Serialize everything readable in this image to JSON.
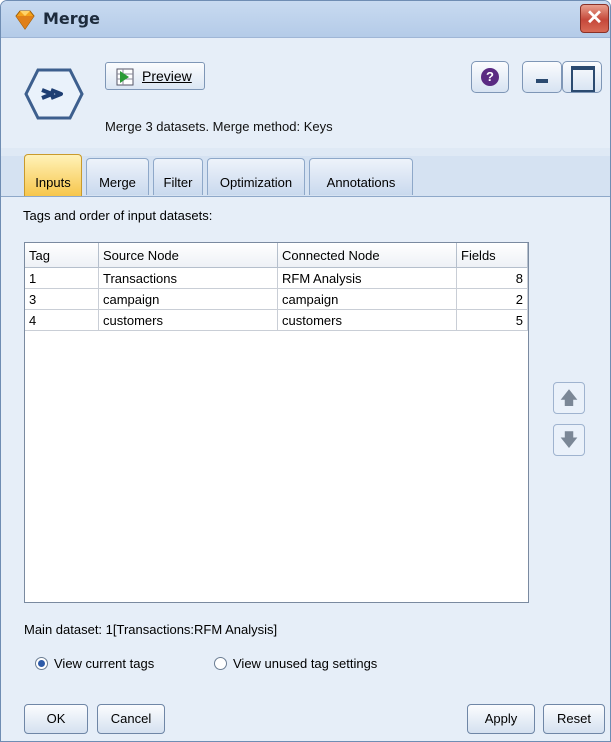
{
  "window": {
    "title": "Merge",
    "close_icon": "close-icon",
    "title_icon": "diamond-gem-icon"
  },
  "toolbar": {
    "preview_label": "Preview",
    "help_icon": "help-icon",
    "minimize_icon": "minimize-icon",
    "maximize_icon": "maximize-icon"
  },
  "node": {
    "icon": "merge-node-icon",
    "summary": "Merge 3 datasets. Merge method: Keys"
  },
  "tabs": [
    {
      "label": "Inputs",
      "active": true
    },
    {
      "label": "Merge",
      "active": false
    },
    {
      "label": "Filter",
      "active": false
    },
    {
      "label": "Optimization",
      "active": false
    },
    {
      "label": "Annotations",
      "active": false
    }
  ],
  "inputs": {
    "section_label": "Tags and order of input datasets:",
    "columns": [
      "Tag",
      "Source Node",
      "Connected Node",
      "Fields"
    ],
    "rows": [
      {
        "tag": "1",
        "source": "Transactions",
        "connected": "RFM Analysis",
        "fields": "8"
      },
      {
        "tag": "3",
        "source": "campaign",
        "connected": "campaign",
        "fields": "2"
      },
      {
        "tag": "4",
        "source": "customers",
        "connected": "customers",
        "fields": "5"
      }
    ],
    "move_up_icon": "arrow-up-icon",
    "move_down_icon": "arrow-down-icon",
    "main_dataset": "Main dataset: 1[Transactions:RFM Analysis]",
    "radio_current": "View current tags",
    "radio_unused": "View unused tag settings",
    "selected_radio": "View current tags"
  },
  "buttons": {
    "ok": "OK",
    "cancel": "Cancel",
    "apply": "Apply",
    "reset": "Reset"
  },
  "colors": {
    "active_tab": "#f7c64c",
    "window_bg": "#e6eef8",
    "close_button": "#c5483a"
  }
}
